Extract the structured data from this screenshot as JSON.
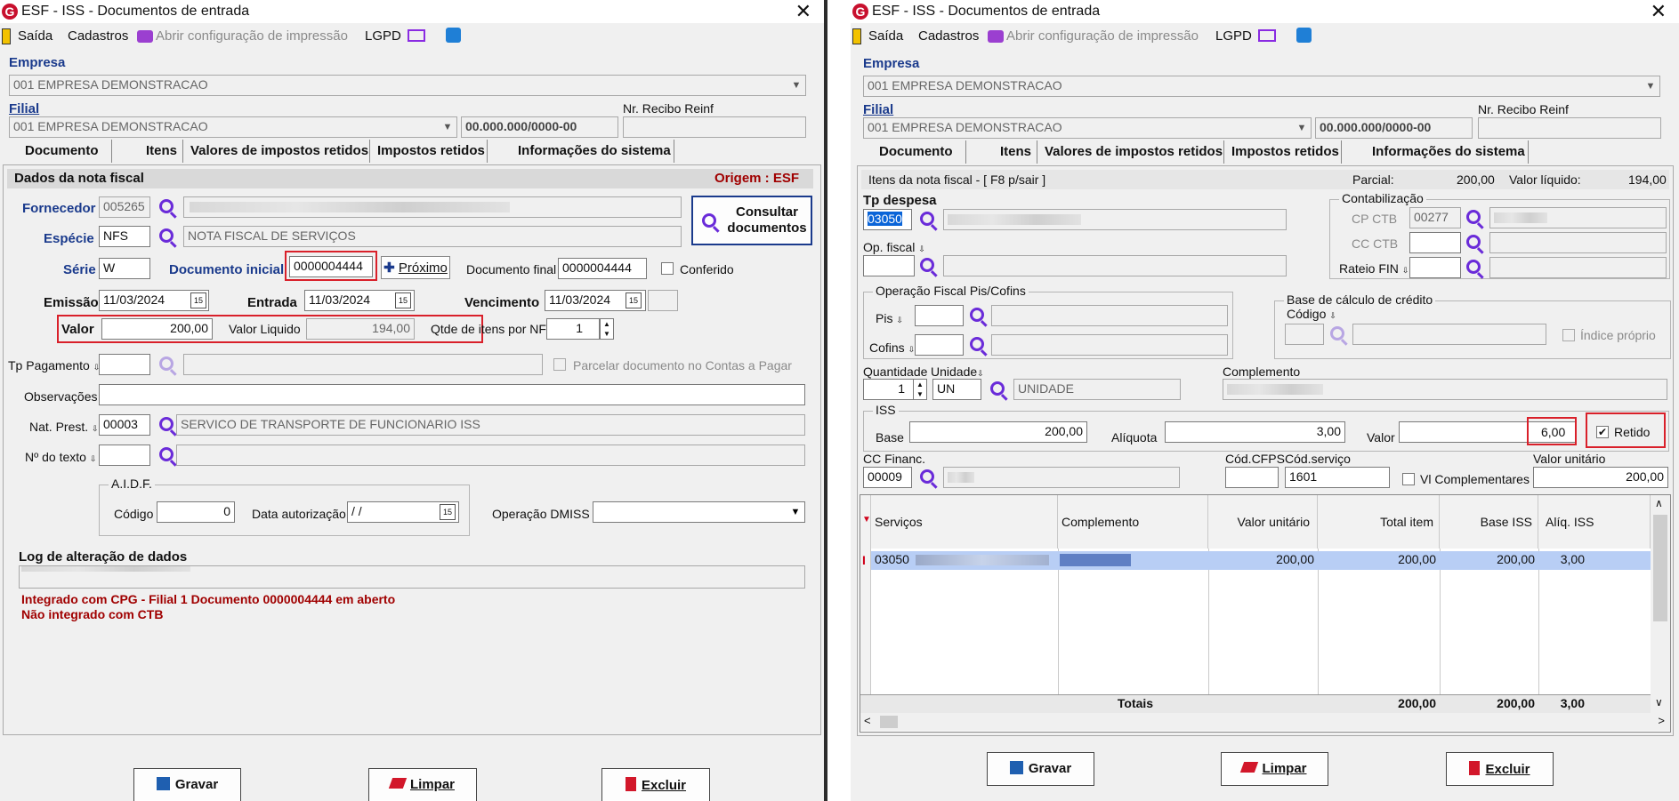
{
  "window_title": "ESF - ISS - Documentos de entrada",
  "app_logo": "G",
  "menu": {
    "exit": "Saída",
    "registers": "Cadastros",
    "print_config": "Abrir configuração de impressão",
    "lgpd": "LGPD"
  },
  "common": {
    "company_label": "Empresa",
    "company_value": "001 EMPRESA DEMONSTRACAO",
    "branch_label": "Filial",
    "branch_value": "001 EMPRESA DEMONSTRACAO",
    "cnpj": "00.000.000/0000-00",
    "reinf_label": "Nr. Recibo Reinf"
  },
  "tabs": {
    "document": "Documento",
    "items": "Itens",
    "withheld_values": "Valores de impostos retidos",
    "withheld_taxes": "Impostos retidos",
    "system_info": "Informações do sistema"
  },
  "left": {
    "section_title": "Dados da nota fiscal",
    "origin": "Origem : ESF",
    "supplier_label": "Fornecedor",
    "supplier_code": "005265",
    "species_label": "Espécie",
    "species_code": "NFS",
    "species_desc": "NOTA FISCAL DE SERVIÇOS",
    "consult_button": "Consultar documentos",
    "series_label": "Série",
    "series_value": "W",
    "initial_doc_label": "Documento inicial",
    "initial_doc_value": "0000004444",
    "next_button": "Próximo",
    "final_doc_label": "Documento final",
    "final_doc_value": "0000004444",
    "checked_label": "Conferido",
    "issue_label": "Emissão",
    "issue_value": "11/03/2024",
    "entry_label": "Entrada",
    "entry_value": "11/03/2024",
    "due_label": "Vencimento",
    "due_value": "11/03/2024",
    "value_label": "Valor",
    "value_value": "200,00",
    "net_label": "Valor Liquido",
    "net_value": "194,00",
    "qty_items_label": "Qtde de itens por NF",
    "qty_items_value": "1",
    "payment_type_label": "Tp Pagamento",
    "installments_label": "Parcelar documento no Contas a Pagar",
    "notes_label": "Observações",
    "nat_label": "Nat. Prest.",
    "nat_code": "00003",
    "nat_desc": "SERVICO DE TRANSPORTE DE FUNCIONARIO ISS",
    "text_no_label": "Nº do texto",
    "aidf_title": "A.I.D.F.",
    "aidf_code_label": "Código",
    "aidf_code_value": "0",
    "aidf_date_label": "Data autorização",
    "aidf_date_value": "/ /",
    "dmiss_label": "Operação DMISS",
    "log_label": "Log de alteração de dados",
    "msg1": "Integrado com CPG - Filial 1 Documento 0000004444 em aberto",
    "msg2": "Não integrado com CTB"
  },
  "buttons": {
    "save": "Gravar",
    "clear": "Limpar",
    "delete": "Excluir"
  },
  "right": {
    "items_header": "Itens da nota fiscal - [ F8 p/sair ]",
    "partial_label": "Parcial:",
    "partial_value": "200,00",
    "net_label": "Valor líquido:",
    "net_value": "194,00",
    "expense_type_label": "Tp despesa",
    "expense_type_value": "03050",
    "accounting_title": "Contabilização",
    "cp_ctb_label": "CP CTB",
    "cp_ctb_value": "00277",
    "cc_ctb_label": "CC CTB",
    "rateio_label": "Rateio FIN",
    "fiscal_op_label": "Op. fiscal",
    "pis_cofins_title": "Operação Fiscal Pis/Cofins",
    "pis_label": "Pis",
    "cofins_label": "Cofins",
    "credit_base_title": "Base de cálculo de crédito",
    "code_label": "Código",
    "own_index_label": "Índice próprio",
    "quantity_label": "Quantidade",
    "quantity_value": "1",
    "unit_label": "Unidade",
    "unit_value": "UN",
    "unit_desc": "UNIDADE",
    "complement_label": "Complemento",
    "iss_title": "ISS",
    "base_label": "Base",
    "base_value": "200,00",
    "rate_label": "Alíquota",
    "rate_value": "3,00",
    "value_label": "Valor",
    "value_value": "6,00",
    "withheld_label": "Retido",
    "cc_fin_label": "CC Financ.",
    "cc_fin_value": "00009",
    "cfps_label": "Cód.CFPS",
    "service_code_label": "Cód.serviço",
    "service_code_value": "1601",
    "vl_compl_label": "Vl Complementares",
    "unit_value_label": "Valor unitário",
    "unit_value_value": "200,00",
    "grid": {
      "headers": [
        "Serviços",
        "Complemento",
        "Valor unitário",
        "Total item",
        "Base ISS",
        "Alíq. ISS"
      ],
      "row": {
        "service": "03050",
        "unit_value": "200,00",
        "total": "200,00",
        "base": "200,00",
        "rate": "3,00"
      },
      "totals_label": "Totais",
      "totals": {
        "total": "200,00",
        "base": "200,00",
        "rate": "3,00"
      }
    }
  }
}
